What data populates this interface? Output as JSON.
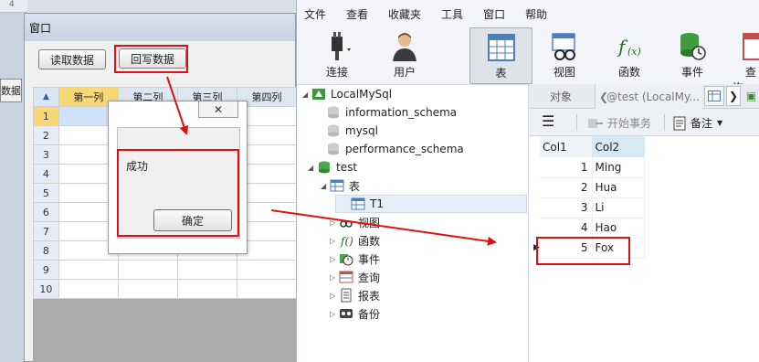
{
  "background": {
    "ruler_mark": "4",
    "clipped_button": "数据"
  },
  "form": {
    "title": "窗口",
    "read_button": "读取数据",
    "write_button": "回写数据",
    "grid": {
      "columns": [
        "第一列",
        "第二列",
        "第三列",
        "第四列"
      ],
      "rows": [
        "1",
        "2",
        "3",
        "4",
        "5",
        "6",
        "7",
        "8",
        "9",
        "10"
      ]
    }
  },
  "dialog": {
    "close": "✕",
    "message": "成功",
    "ok": "确定"
  },
  "navicat": {
    "menu": [
      "文件",
      "查看",
      "收藏夹",
      "工具",
      "窗口",
      "帮助"
    ],
    "toolbar": [
      "连接",
      "用户",
      "表",
      "视图",
      "函数",
      "事件",
      "查询"
    ],
    "tree": {
      "connection": "LocalMySql",
      "databases": [
        "information_schema",
        "mysql",
        "performance_schema",
        "test"
      ],
      "tables_group": "表",
      "table": "T1",
      "groups": [
        "视图",
        "函数",
        "事件",
        "查询",
        "报表",
        "备份"
      ]
    },
    "tabs": {
      "objects": "对象",
      "table_tab": "@test (LocalMy..."
    },
    "subbar": {
      "begin_transaction": "开始事务",
      "memo": "备注"
    },
    "data": {
      "columns": [
        "Col1",
        "Col2"
      ],
      "rows": [
        {
          "col1": "1",
          "col2": "Ming"
        },
        {
          "col1": "2",
          "col2": "Hua"
        },
        {
          "col1": "3",
          "col2": "Li"
        },
        {
          "col1": "4",
          "col2": "Hao"
        },
        {
          "col1": "5",
          "col2": "Fox"
        }
      ]
    }
  },
  "colors": {
    "annotation_red": "#e01010",
    "selected_header": "#f7d874"
  }
}
